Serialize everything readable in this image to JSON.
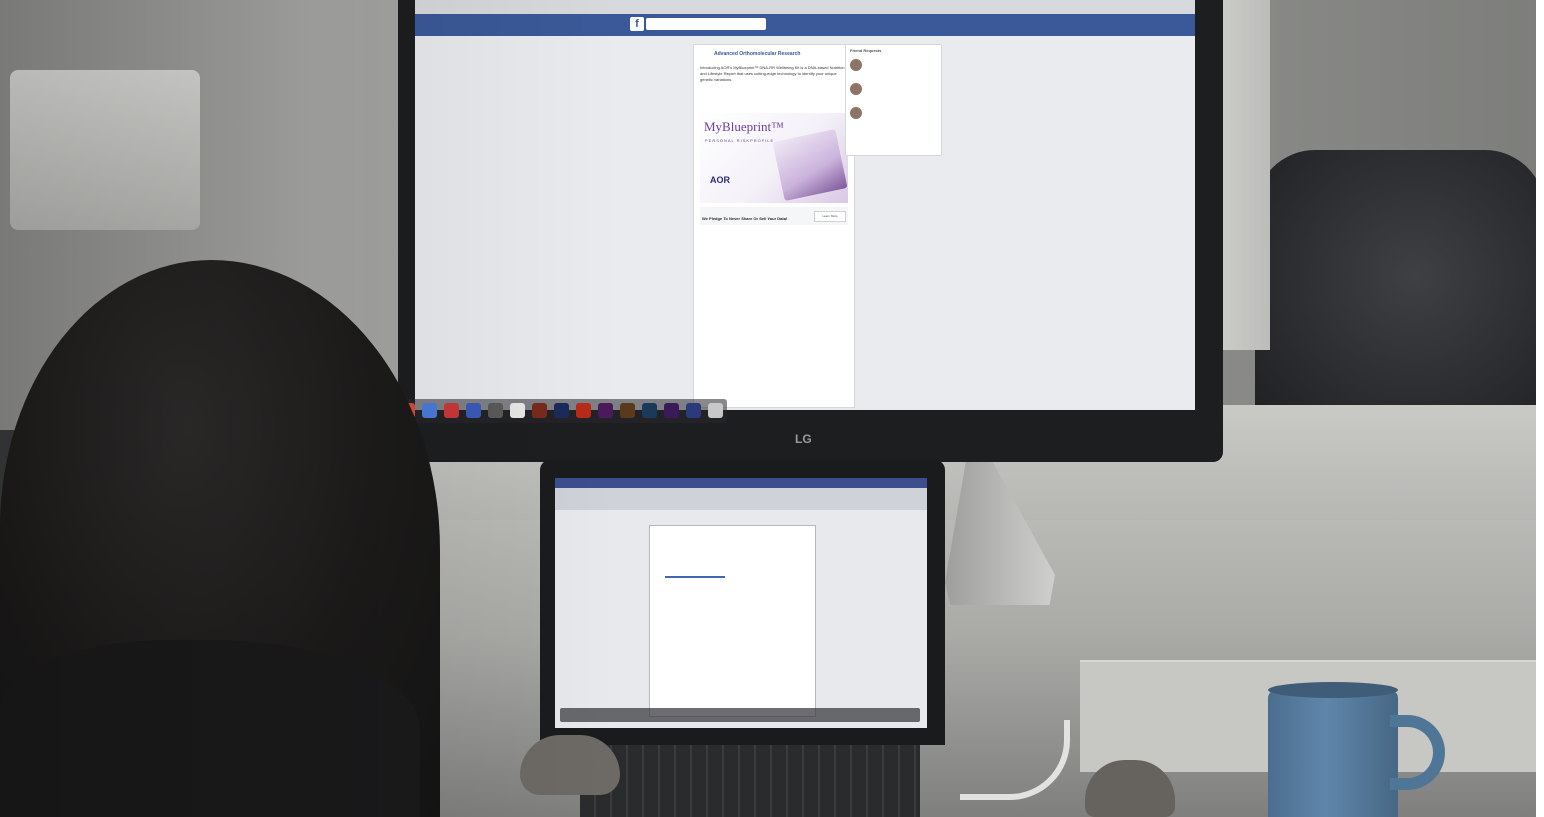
{
  "scene": {
    "description_free": true,
    "monitor": {
      "brand": "LG",
      "post": {
        "author": "Advanced Orthomolecular Research",
        "text": "Introducing AOR's MyBlueprint™ DNA-RR Wellbeing Kit is a DNA-based Nutrition and Lifestyle Report that uses cutting-edge technology to identify your unique genetic variations.",
        "ad": {
          "brand_title": "MyBlueprint™",
          "brand_subtitle": "PERSONAL RISKPROFILE",
          "logo": "AOR"
        },
        "cta": {
          "headline": "We Pledge To Never Share Or Sell Your Data!",
          "button": "Learn More"
        }
      },
      "sidebar": {
        "title": "Friend Requests"
      }
    },
    "colors": {
      "facebook_blue": "#3b5998",
      "brand_purple": "#6b3fa0",
      "mug_blue": "#5f86aa"
    },
    "icons": [
      "facebook-logo-icon",
      "dock-app-icons"
    ]
  }
}
